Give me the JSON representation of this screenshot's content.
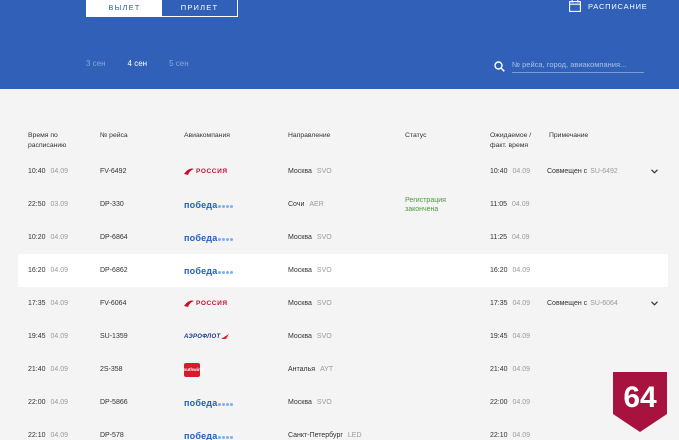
{
  "header": {
    "tabs": [
      {
        "label": "ВЫЛЕТ",
        "active": true
      },
      {
        "label": "ПРИЛЕТ",
        "active": false
      }
    ],
    "schedule_label": "РАСПИСАНИЕ",
    "dates": [
      {
        "label": "3 сен",
        "active": false
      },
      {
        "label": "4 сен",
        "active": true
      },
      {
        "label": "5 сен",
        "active": false
      }
    ],
    "search_placeholder": "№ рейса, город, авиакомпания..."
  },
  "columns": {
    "time": "Время по расписанию",
    "flight": "№ рейса",
    "airline": "Авиакомпания",
    "direction": "Направление",
    "status": "Статус",
    "expected": "Ожидаемое / факт. время",
    "note": "Примечание"
  },
  "rows": [
    {
      "time": "10:40",
      "date": "04.09",
      "flight": "FV-6492",
      "airline": "РОССИЯ",
      "airline_logo": "rossiya",
      "city": "Москва",
      "code": "SVO",
      "status": "",
      "exp_time": "10:40",
      "exp_date": "04.09",
      "note": "Совмещен с",
      "note_flight": "SU-6492",
      "expandable": true
    },
    {
      "time": "22:50",
      "date": "03.09",
      "flight": "DP-330",
      "airline": "победа",
      "airline_logo": "pobeda",
      "city": "Сочи",
      "code": "AER",
      "status": "Регистрация закончена",
      "exp_time": "11:05",
      "exp_date": "04.09",
      "note": "",
      "note_flight": "",
      "expandable": false
    },
    {
      "time": "10:20",
      "date": "04.09",
      "flight": "DP-6864",
      "airline": "победа",
      "airline_logo": "pobeda",
      "city": "Москва",
      "code": "SVO",
      "status": "",
      "exp_time": "11:25",
      "exp_date": "04.09",
      "note": "",
      "note_flight": "",
      "expandable": false
    },
    {
      "time": "16:20",
      "date": "04.09",
      "flight": "DP-6862",
      "airline": "победа",
      "airline_logo": "pobeda",
      "city": "Москва",
      "code": "SVO",
      "status": "",
      "exp_time": "16:20",
      "exp_date": "04.09",
      "note": "",
      "note_flight": "",
      "expandable": false,
      "highlight": true
    },
    {
      "time": "17:35",
      "date": "04.09",
      "flight": "FV-6064",
      "airline": "РОССИЯ",
      "airline_logo": "rossiya",
      "city": "Москва",
      "code": "SVO",
      "status": "",
      "exp_time": "17:35",
      "exp_date": "04.09",
      "note": "Совмещен с",
      "note_flight": "SU-6064",
      "expandable": true
    },
    {
      "time": "19:45",
      "date": "04.09",
      "flight": "SU-1359",
      "airline": "АЭРОФЛОТ",
      "airline_logo": "aeroflot",
      "city": "Москва",
      "code": "SVO",
      "status": "",
      "exp_time": "19:45",
      "exp_date": "04.09",
      "note": "",
      "note_flight": "",
      "expandable": false
    },
    {
      "time": "21:40",
      "date": "04.09",
      "flight": "2S-358",
      "airline": "Southwind",
      "airline_logo": "southwind",
      "city": "Анталья",
      "code": "AYT",
      "status": "",
      "exp_time": "21:40",
      "exp_date": "04.09",
      "note": "",
      "note_flight": "",
      "expandable": false
    },
    {
      "time": "22:00",
      "date": "04.09",
      "flight": "DP-5866",
      "airline": "победа",
      "airline_logo": "pobeda",
      "city": "Москва",
      "code": "SVO",
      "status": "",
      "exp_time": "22:00",
      "exp_date": "04.09",
      "note": "",
      "note_flight": "",
      "expandable": false
    },
    {
      "time": "22:10",
      "date": "04.09",
      "flight": "DP-578",
      "airline": "победа",
      "airline_logo": "pobeda",
      "city": "Санкт-Петербург",
      "code": "LED",
      "status": "",
      "exp_time": "22:10",
      "exp_date": "04.09",
      "note": "",
      "note_flight": "",
      "expandable": false
    }
  ],
  "badge": {
    "text": "64",
    "color": "#a8123f"
  },
  "colors": {
    "header": "#3060b8",
    "status_green": "#4a9a3a"
  }
}
